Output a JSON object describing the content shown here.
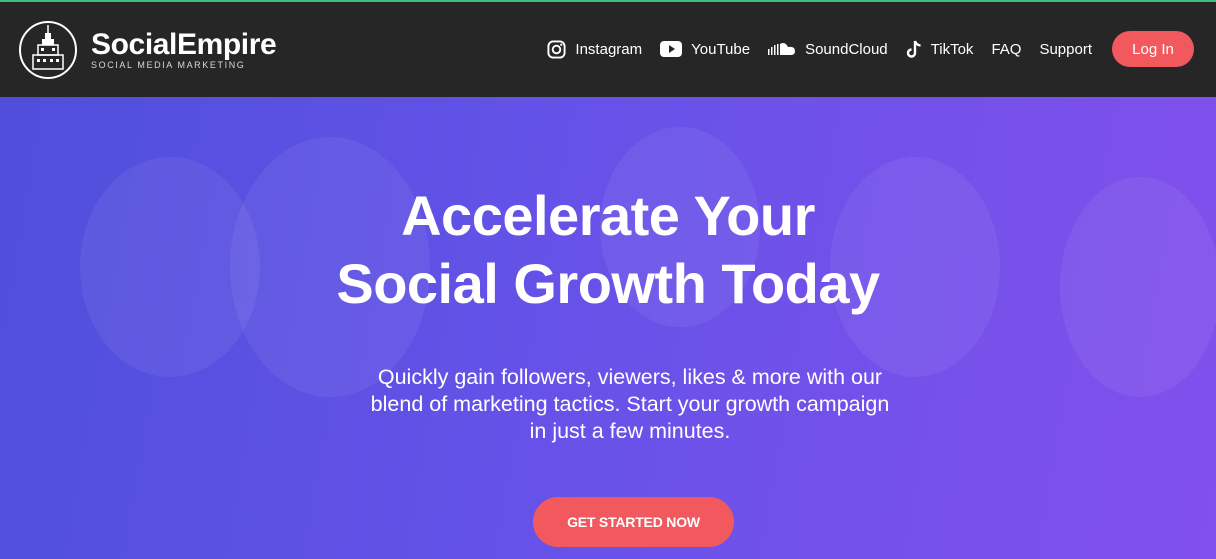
{
  "brand": {
    "name": "SocialEmpire",
    "tagline": "SOCIAL MEDIA MARKETING",
    "logo_icon": "empire-state-building-icon"
  },
  "nav": {
    "items": [
      {
        "label": "Instagram",
        "icon": "instagram-icon"
      },
      {
        "label": "YouTube",
        "icon": "youtube-icon"
      },
      {
        "label": "SoundCloud",
        "icon": "soundcloud-icon"
      },
      {
        "label": "TikTok",
        "icon": "tiktok-icon"
      },
      {
        "label": "FAQ"
      },
      {
        "label": "Support"
      }
    ],
    "login_label": "Log In"
  },
  "hero": {
    "title_line1": "Accelerate Your",
    "title_line2": "Social Growth Today",
    "subtitle_line1": "Quickly gain followers, viewers, likes & more with our",
    "subtitle_line2": "blend of marketing tactics. Start your growth campaign",
    "subtitle_line3": "in just a few minutes.",
    "cta_label": "GET STARTED NOW"
  },
  "colors": {
    "header_bg": "#262626",
    "accent": "#f2595e",
    "hero_gradient_start": "#4f4fdc",
    "hero_gradient_end": "#8250ec",
    "top_line": "#3fbf7f"
  }
}
